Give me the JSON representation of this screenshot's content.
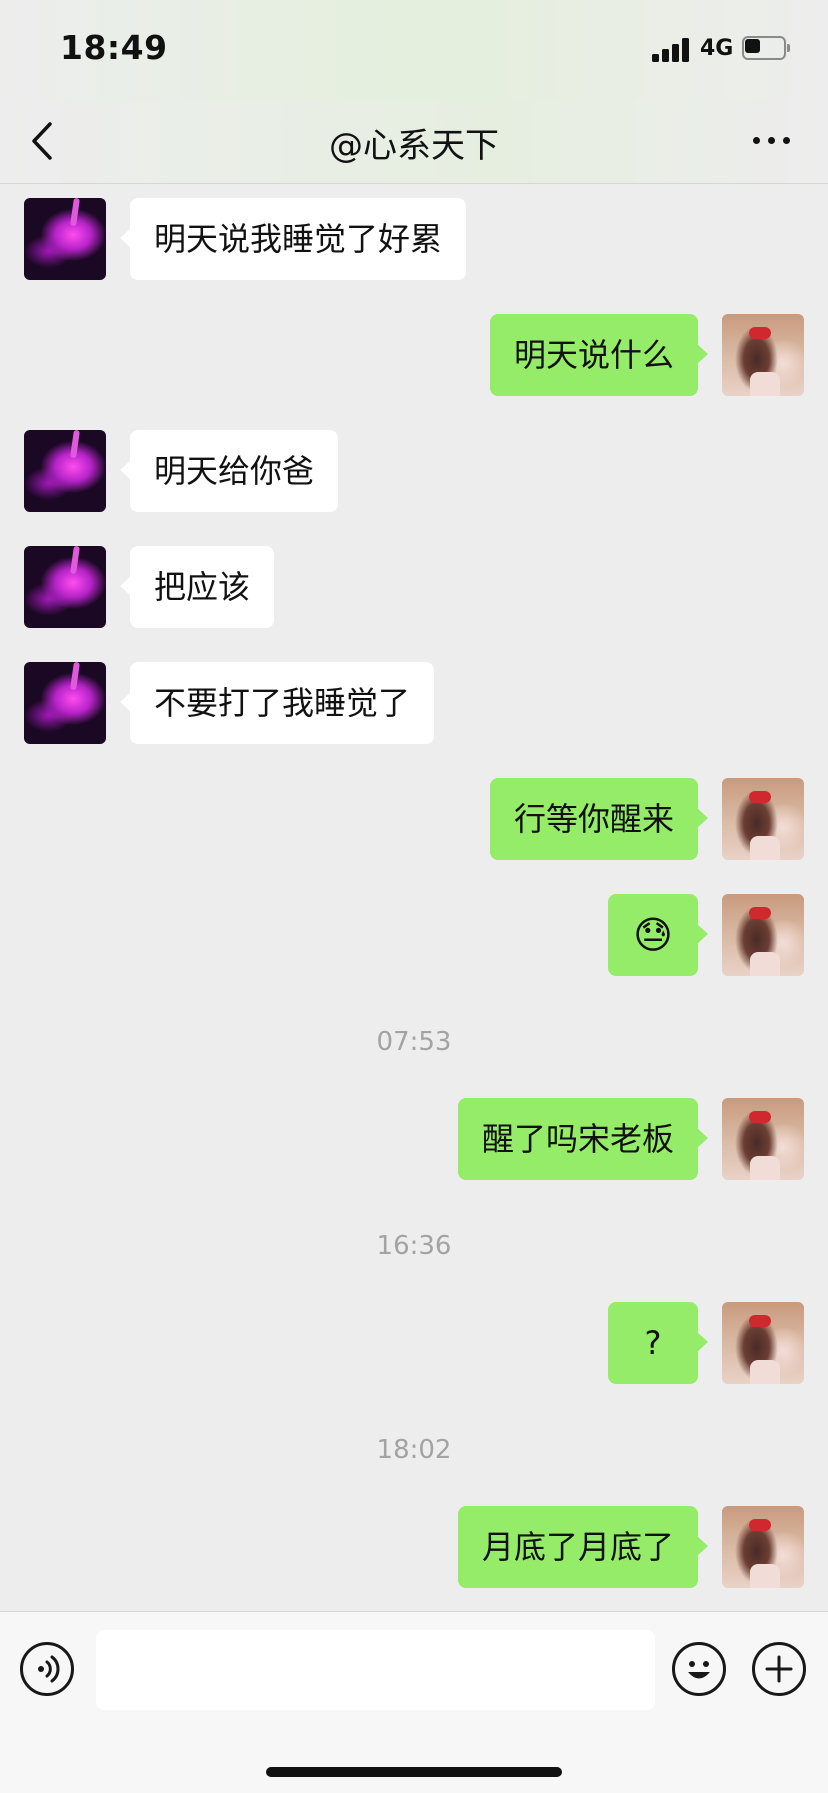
{
  "status_bar": {
    "time": "18:49",
    "network": "4G",
    "battery_level": 0.45
  },
  "nav": {
    "title": "@心系天下",
    "back_icon": "chevron-left-icon",
    "more_icon": "more-horizontal-icon"
  },
  "messages": [
    {
      "sender": "friend",
      "text": "明天说我睡觉了好累"
    },
    {
      "sender": "self",
      "text": "明天说什么"
    },
    {
      "sender": "friend",
      "text": "明天给你爸"
    },
    {
      "sender": "friend",
      "text": "把应该"
    },
    {
      "sender": "friend",
      "text": "不要打了我睡觉了"
    },
    {
      "sender": "self",
      "text": "行等你醒来"
    },
    {
      "sender": "self",
      "text": "😓"
    },
    {
      "timestamp": "07:53"
    },
    {
      "sender": "self",
      "text": "醒了吗宋老板"
    },
    {
      "timestamp": "16:36"
    },
    {
      "sender": "self",
      "text": "?"
    },
    {
      "timestamp": "18:02"
    },
    {
      "sender": "self",
      "text": "月底了月底了"
    }
  ],
  "input_bar": {
    "voice_icon": "voice-input-icon",
    "input_value": "",
    "emoji_icon": "emoji-icon",
    "add_icon": "add-circle-icon"
  },
  "colors": {
    "self_bubble": "#95ec69",
    "friend_bubble": "#ffffff",
    "background": "#ededed",
    "timestamp_text": "#a3a3a3"
  }
}
